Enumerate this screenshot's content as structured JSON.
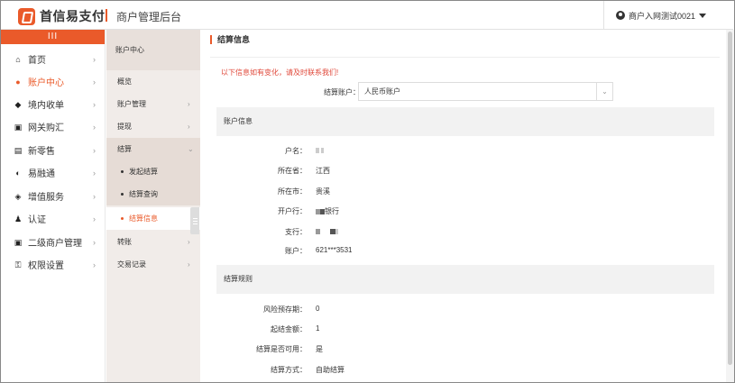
{
  "header": {
    "brand": "首信易支付",
    "title": "商户管理后台",
    "user": "商户入网测试0021"
  },
  "sidebar": {
    "toggle": "III",
    "items": [
      {
        "label": "首页",
        "icon": "home-icon",
        "glyph": "⌂"
      },
      {
        "label": "账户中心",
        "icon": "user-icon",
        "glyph": "●"
      },
      {
        "label": "境内收单",
        "icon": "layers-icon",
        "glyph": "◆"
      },
      {
        "label": "网关购汇",
        "icon": "bank-icon",
        "glyph": "▣"
      },
      {
        "label": "新零售",
        "icon": "cart-icon",
        "glyph": "▤"
      },
      {
        "label": "易融通",
        "icon": "finance-icon",
        "glyph": "◐"
      },
      {
        "label": "增值服务",
        "icon": "diamond-icon",
        "glyph": "◈"
      },
      {
        "label": "认证",
        "icon": "person-icon",
        "glyph": "♟"
      },
      {
        "label": "二级商户管理",
        "icon": "id-card-icon",
        "glyph": "▣"
      },
      {
        "label": "权限设置",
        "icon": "key-icon",
        "glyph": "⚿"
      }
    ],
    "arrow": "›"
  },
  "submenu": {
    "head": "账户中心",
    "items": [
      {
        "label": "概览"
      },
      {
        "label": "账户管理"
      },
      {
        "label": "提现"
      },
      {
        "label": "结算"
      },
      {
        "label": "发起结算"
      },
      {
        "label": "结算查询"
      },
      {
        "label": "结算信息"
      },
      {
        "label": "转账"
      },
      {
        "label": "交易记录"
      }
    ],
    "arrow": "›",
    "arrow_down": "⌄"
  },
  "content": {
    "title": "结算信息",
    "notice": "以下信息如有变化，请及时联系我们!",
    "account_label": "结算账户：",
    "account_value": "人民币账户",
    "select_arrow": "⌄",
    "section_account": "账户信息",
    "section_rules": "结算规则",
    "account_rows": [
      {
        "k": "户名：",
        "v": ""
      },
      {
        "k": "所在省：",
        "v": "江西"
      },
      {
        "k": "所在市：",
        "v": "贵溪"
      },
      {
        "k": "开户行：",
        "v": "银行"
      },
      {
        "k": "支行：",
        "v": ""
      },
      {
        "k": "账户：",
        "v": "621***3531"
      }
    ],
    "rule_rows": [
      {
        "k": "风险预存期：",
        "v": "0"
      },
      {
        "k": "起结金额：",
        "v": "1"
      },
      {
        "k": "结算是否可用：",
        "v": "是"
      },
      {
        "k": "结算方式：",
        "v": "自助结算"
      }
    ]
  },
  "colors": {
    "accent": "#ea5a2a",
    "notice": "#e0483a"
  }
}
